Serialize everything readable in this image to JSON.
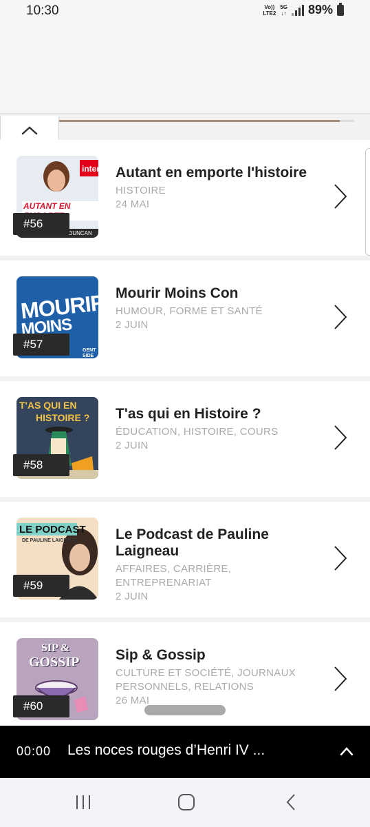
{
  "status": {
    "time": "10:30",
    "net1_top": "Vo))",
    "net1_bottom": "LTE2",
    "net2_top": "5G",
    "net2_bottom": "↓↑",
    "battery": "89%"
  },
  "progress": 0.95,
  "episodes": [
    {
      "number": "#56",
      "title": "Autant en emporte l'histoire",
      "categories": "HISTOIRE",
      "date": "24 MAI",
      "cover_text": "AUTANT EN EMPORTE",
      "cover_sub": "STÉPHANIE DUNCAN",
      "cover_brand": "inter",
      "colors": {
        "bg": "#e9eef4"
      }
    },
    {
      "number": "#57",
      "title": "Mourir Moins Con",
      "categories": "HUMOUR, FORME ET SANTÉ",
      "date": "2 JUIN",
      "cover_text": "MOURIR",
      "cover_text2": "MOINS CON",
      "cover_brand": "GENT SIDE",
      "colors": {
        "bg": "#1e5fa8"
      }
    },
    {
      "number": "#58",
      "title": "T'as qui en Histoire ?",
      "categories": "ÉDUCATION, HISTOIRE, COURS",
      "date": "2 JUIN",
      "cover_text": "T'AS QUI EN",
      "cover_text2": "HISTOIRE ?",
      "colors": {
        "bg": "#34445c"
      }
    },
    {
      "number": "#59",
      "title": "Le Podcast de Pauline Laigneau",
      "categories": "AFFAIRES, CARRIÈRE, ENTREPRENARIAT",
      "date": "2 JUIN",
      "cover_text": "LE PODCAST",
      "cover_sub": "DE PAULINE LAIGNEAU",
      "colors": {
        "bg": "#f4dfc4"
      }
    },
    {
      "number": "#60",
      "title": "Sip & Gossip",
      "categories": "CULTURE ET SOCIÉTÉ, JOURNAUX PERSONNELS, RELATIONS",
      "date": "26 MAI",
      "cover_text": "SIP &",
      "cover_text2": "GOSSIP",
      "colors": {
        "bg": "#b9a4bd"
      }
    }
  ],
  "player": {
    "time": "00:00",
    "title": "Les noces rouges d’Henri IV ..."
  },
  "icons": {
    "collapse": "chevron-up-icon",
    "row_action": "chevron-right-icon",
    "player_expand": "chevron-up-icon",
    "nav": [
      "recents-icon",
      "home-icon",
      "back-icon"
    ]
  }
}
